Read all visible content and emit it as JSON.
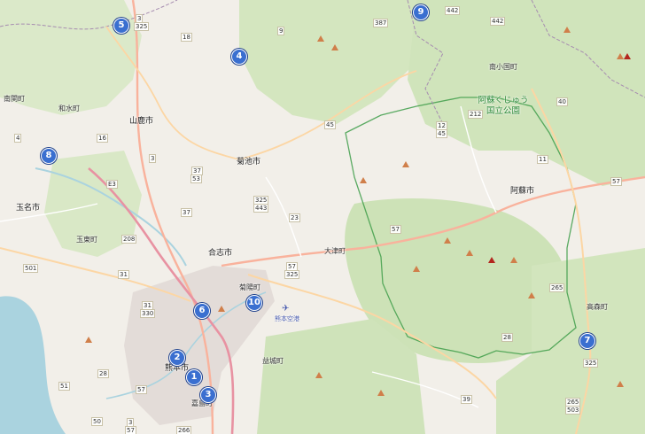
{
  "map": {
    "places": {
      "minami_kanmachi": "南関町",
      "nagomi": "和水町",
      "yamaga": "山鹿市",
      "kikuchi": "菊池市",
      "tamana": "玉名市",
      "tamahigashi": "玉東町",
      "koshi": "合志市",
      "ozu": "大津町",
      "kikuyo": "菊陽町",
      "kumamoto": "熊本市",
      "mashiki": "益城町",
      "kashima": "嘉島町",
      "minamioguni": "南小国町",
      "aso": "阿蘇市",
      "takamori": "高森町"
    },
    "park_label": "阿蘇くじゅう国立公園",
    "airport_label": "熊本空港",
    "route_shields": [
      "3",
      "325",
      "18",
      "9",
      "387",
      "442",
      "442",
      "40",
      "212",
      "12",
      "45",
      "45",
      "16",
      "4",
      "3",
      "53",
      "37",
      "11",
      "57",
      "E3",
      "37",
      "325",
      "443",
      "23",
      "208",
      "57",
      "501",
      "31",
      "57",
      "325",
      "265",
      "31",
      "330",
      "28",
      "28",
      "325",
      "51",
      "57",
      "3",
      "57",
      "266",
      "39",
      "265",
      "503",
      "50"
    ],
    "markers": [
      "1",
      "2",
      "3",
      "4",
      "5",
      "6",
      "7",
      "8",
      "9",
      "10"
    ]
  }
}
